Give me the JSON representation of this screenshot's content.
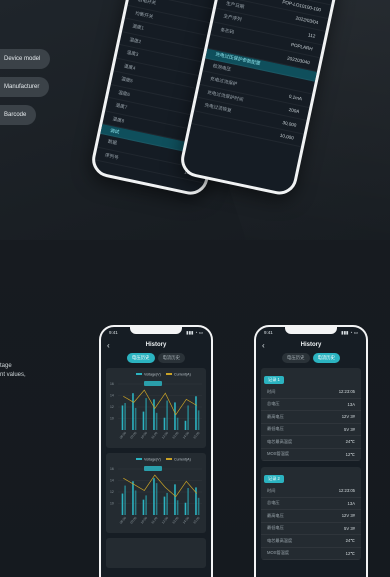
{
  "top_section": {
    "pills": [
      "Device model",
      "Manufacturer",
      "Barcode"
    ]
  },
  "mockup_back": {
    "rows": [
      {
        "label": "开关作动",
        "value": ""
      },
      {
        "label": "充电开关",
        "value": ""
      },
      {
        "label": "放电开关",
        "value": ""
      },
      {
        "label": "均衡开关",
        "value": ""
      },
      {
        "label": "温度1",
        "value": ""
      },
      {
        "label": "温度2",
        "value": ""
      },
      {
        "label": "温度3",
        "value": ""
      },
      {
        "label": "温度4",
        "value": ""
      },
      {
        "label": "温度5",
        "value": ""
      },
      {
        "label": "温度6",
        "value": ""
      },
      {
        "label": "温度7",
        "value": ""
      },
      {
        "label": "温度8",
        "value": ""
      }
    ],
    "toggle_label": "OFF",
    "footer_tag": "调试",
    "footer_rows": [
      {
        "label": "数据",
        "value": "10008"
      },
      {
        "label": "序列号",
        "value": "10065"
      }
    ]
  },
  "mockup_front": {
    "rows": [
      {
        "label": "",
        "value": "65005"
      },
      {
        "label": "产品型号",
        "value": "2"
      },
      {
        "label": "厂商",
        "value": "POP-LO10100-100"
      },
      {
        "label": "生产日期",
        "value": "2022/03/04"
      },
      {
        "label": "生产序列",
        "value": "112"
      },
      {
        "label": "条形码",
        "value": "POPLARH"
      },
      {
        "label": "",
        "value": "202203040"
      }
    ],
    "section_header": "充电过压保护参数配置",
    "section_rows": [
      {
        "label": "检测电压",
        "value": ""
      },
      {
        "label": "充电过流保护",
        "value": "0.1mA"
      },
      {
        "label": "充电过流保护时间",
        "value": "200A"
      },
      {
        "label": "充电过流恢复",
        "value": "30,000"
      },
      {
        "label": "",
        "value": "10,000"
      }
    ]
  },
  "bottom_section": {
    "side_text": [
      "tage",
      "nt values,"
    ]
  },
  "phone_chart": {
    "time": "9:41",
    "title": "History",
    "tabs": [
      "电压历史",
      "电流历史"
    ],
    "active_tab": 0,
    "legend": [
      "Voltage(V)",
      "Current(A)"
    ],
    "colors": {
      "bar": "#2bb3c0",
      "line": "#c9a227",
      "highlight": "#2bb3c0"
    }
  },
  "chart_data": [
    {
      "type": "bar",
      "categories": [
        "08:00",
        "09:00",
        "10:00",
        "11:00",
        "12:00",
        "13:00",
        "14:00",
        "15:00"
      ],
      "series": [
        {
          "name": "Voltage(V)",
          "values": [
            8,
            12,
            6,
            10,
            4,
            9,
            3,
            11
          ]
        },
        {
          "name": "Current(A)",
          "values": [
            11,
            9,
            13,
            7,
            12,
            5,
            10,
            8
          ]
        }
      ],
      "ylim": [
        0,
        15
      ],
      "yticks": [
        10,
        12,
        14,
        16
      ]
    },
    {
      "type": "bar",
      "categories": [
        "08:00",
        "09:00",
        "10:00",
        "11:00",
        "12:00",
        "13:00",
        "14:00",
        "15:00"
      ],
      "series": [
        {
          "name": "Voltage(V)",
          "values": [
            7,
            11,
            5,
            12,
            6,
            10,
            4,
            9
          ]
        },
        {
          "name": "Current(A)",
          "values": [
            12,
            10,
            8,
            13,
            9,
            6,
            11,
            7
          ]
        }
      ],
      "ylim": [
        0,
        15
      ],
      "yticks": [
        10,
        12,
        14,
        16
      ]
    }
  ],
  "phone_records": {
    "time": "9:41",
    "title": "History",
    "tabs": [
      "电压历史",
      "电流历史"
    ],
    "active_tab": 1,
    "records": [
      {
        "tag": "记录 1",
        "rows": [
          {
            "label": "时间",
            "value": "12:23:05"
          },
          {
            "label": "总电压",
            "value": "13A"
          },
          {
            "label": "最高电压",
            "value": "12V  3#"
          },
          {
            "label": "最低电压",
            "value": "5V  3#"
          },
          {
            "label": "电芯最高温度",
            "value": "24℃"
          },
          {
            "label": "MOS管温度",
            "value": "12℃"
          }
        ]
      },
      {
        "tag": "记录 2",
        "rows": [
          {
            "label": "时间",
            "value": "12:23:05"
          },
          {
            "label": "总电压",
            "value": "13A"
          },
          {
            "label": "最高电压",
            "value": "12V  3#"
          },
          {
            "label": "最低电压",
            "value": "5V  3#"
          },
          {
            "label": "电芯最高温度",
            "value": "24℃"
          },
          {
            "label": "MOS管温度",
            "value": "12℃"
          }
        ]
      }
    ]
  }
}
